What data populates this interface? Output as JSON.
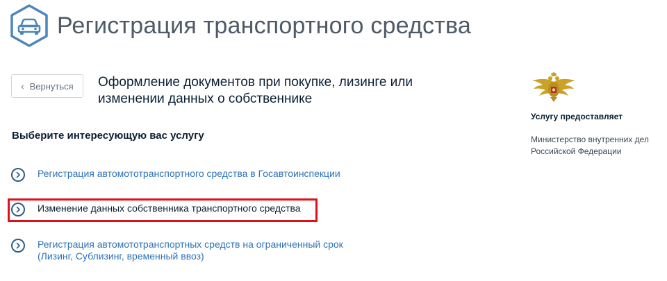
{
  "header": {
    "title": "Регистрация транспортного средства",
    "icon": "car-icon",
    "icon_color": "#4f86b8"
  },
  "back_button": {
    "label": "Вернуться"
  },
  "subtitle": "Оформление документов при покупке, лизинге или изменении данных о собственнике",
  "services": {
    "heading": "Выберите интересующую вас услугу",
    "items": [
      {
        "label": "Регистрация автомототранспортного средства в Госавтоинспекции"
      },
      {
        "label": "Изменение данных собственника транспортного средства",
        "highlighted": true
      },
      {
        "label": "Регистрация автомототранспортных средств на ограниченный срок (Лизинг, Сублизинг, временный ввоз)"
      }
    ]
  },
  "provider": {
    "label": "Услугу предоставляет",
    "name": "Министерство внутренних дел Российской Федерации",
    "icon": "double-headed-eagle-icon"
  },
  "colors": {
    "link": "#2c73b9",
    "text": "#0b1f33",
    "highlight": "#e0101b",
    "emblem_gold": "#c9a227"
  }
}
